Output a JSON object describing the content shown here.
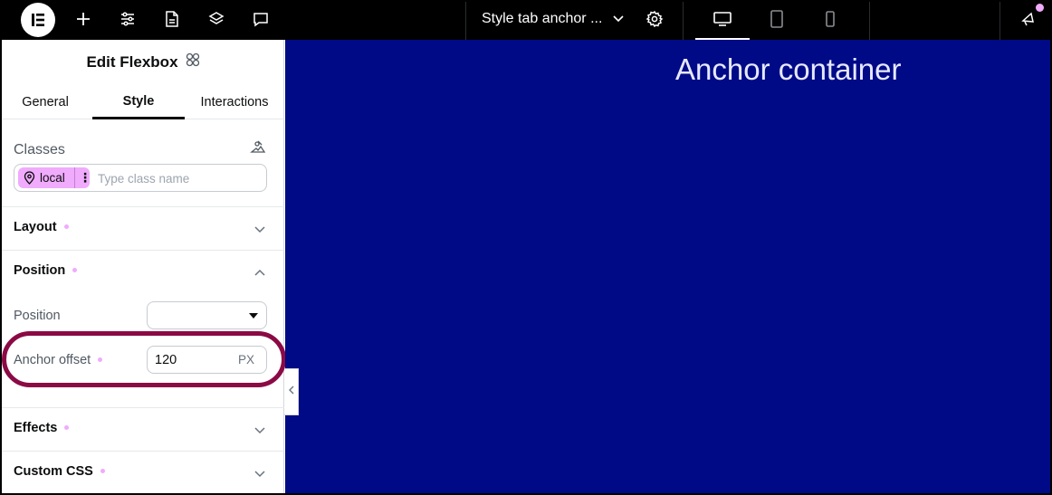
{
  "topbar": {
    "document_title": "Style tab anchor ...",
    "icons": {
      "logo": "elementor-logo-icon",
      "add": "plus-icon",
      "settings": "sliders-icon",
      "pages": "page-icon",
      "structure": "layers-icon",
      "notes": "comment-icon",
      "site_settings": "gear-icon",
      "desktop": "desktop-icon",
      "tablet": "tablet-icon",
      "mobile": "mobile-icon",
      "whats_new": "megaphone-icon"
    },
    "active_device": "desktop"
  },
  "panel": {
    "title": "Edit Flexbox",
    "tabs": [
      {
        "label": "General",
        "active": false
      },
      {
        "label": "Style",
        "active": true
      },
      {
        "label": "Interactions",
        "active": false
      }
    ],
    "classes": {
      "label": "Classes",
      "chip_label": "local",
      "placeholder": "Type class name"
    },
    "sections": {
      "layout": "Layout",
      "position": "Position",
      "effects": "Effects",
      "custom_css": "Custom CSS"
    },
    "position_fields": {
      "position_label": "Position",
      "position_value": "",
      "anchor_label": "Anchor offset",
      "anchor_value": "120",
      "anchor_unit": "PX"
    }
  },
  "canvas": {
    "heading": "Anchor container",
    "background": "#000a86"
  },
  "colors": {
    "accent_pink": "#f0abfc",
    "highlight_ring": "#8b0a45"
  }
}
